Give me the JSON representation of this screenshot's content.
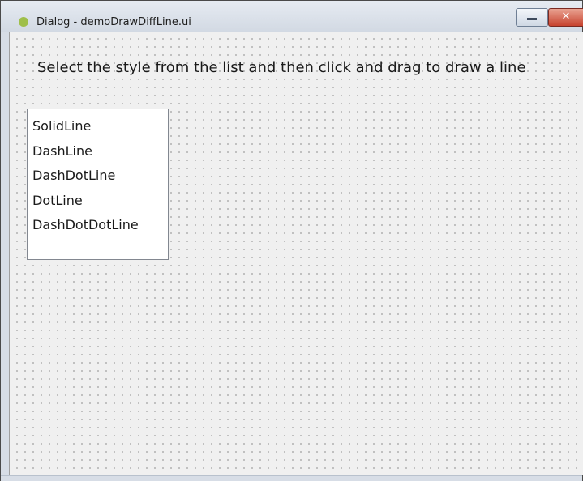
{
  "window": {
    "title": "Dialog - demoDrawDiffLine.ui",
    "app_icon_glyph": "Qt",
    "close_glyph": "✕"
  },
  "instruction": "Select the style from the list and then click and drag to draw a line",
  "line_styles": [
    "SolidLine",
    "DashLine",
    "DashDotLine",
    "DotLine",
    "DashDotDotLine"
  ],
  "icons": {
    "app": "qt-logo-icon",
    "minimize": "minimize-icon",
    "close": "close-icon"
  },
  "colors": {
    "canvas_background": "#f0f0f0",
    "grid_dot": "#b4b4b4",
    "close_button": "#c7432f"
  }
}
